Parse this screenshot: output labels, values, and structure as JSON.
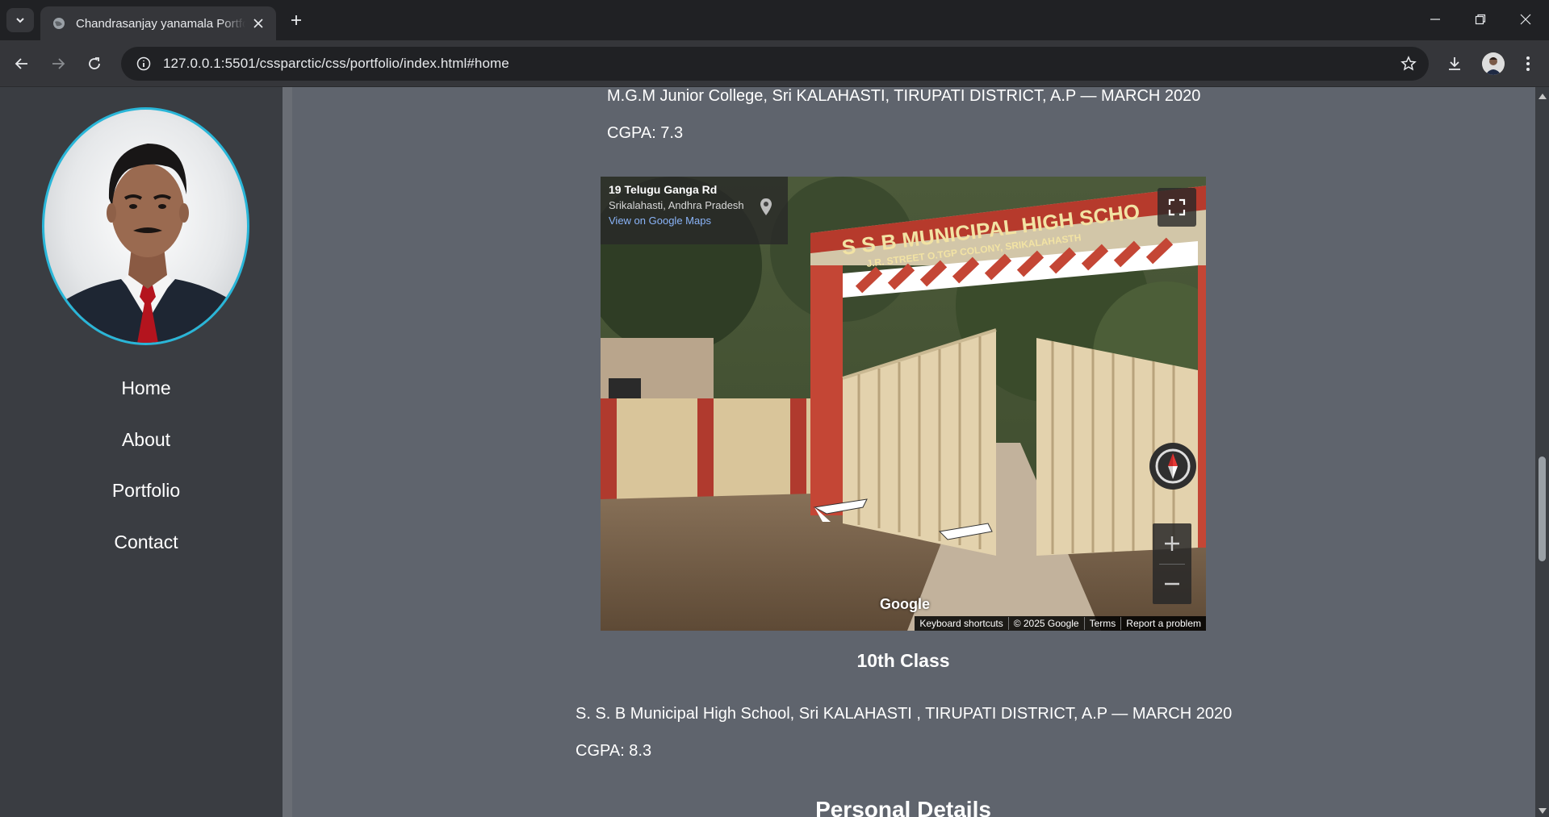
{
  "browser": {
    "tab_title": "Chandrasanjay yanamala Portfolio",
    "url": "127.0.0.1:5501/cssparctic/css/portfolio/index.html#home"
  },
  "sidebar": {
    "nav": [
      {
        "label": "Home"
      },
      {
        "label": "About"
      },
      {
        "label": "Portfolio"
      },
      {
        "label": "Contact"
      }
    ]
  },
  "education": {
    "intermediate": {
      "line": "M.G.M Junior College, Sri KALAHASTI, TIRUPATI DISTRICT, A.P — MARCH 2020",
      "cgpa": "CGPA: 7.3"
    },
    "tenth": {
      "title": "10th Class",
      "line": "S. S. B Municipal High School, Sri KALAHASTI , TIRUPATI DISTRICT, A.P — MARCH 2020",
      "cgpa": "CGPA: 8.3"
    }
  },
  "map": {
    "address_line1": "19 Telugu Ganga Rd",
    "address_line2": "Srikalahasti, Andhra Pradesh",
    "view_link": "View on Google Maps",
    "sign_text": "S S B MUNICIPAL HIGH SCHO",
    "sign_subtext": "J.R. STREET O.TGP COLONY, SRIKALAHASTH",
    "google_logo": "Google",
    "footer": {
      "shortcuts": "Keyboard shortcuts",
      "copyright": "© 2025 Google",
      "terms": "Terms",
      "report": "Report a problem"
    }
  },
  "section_next": {
    "title": "Personal Details"
  },
  "colors": {
    "page_bg": "#5f646d",
    "sidebar_bg": "#3a3d42",
    "profile_ring": "#29b6d8",
    "chrome_dark": "#202124",
    "chrome_mid": "#35363a"
  },
  "icons": [
    "tab-list-icon",
    "globe-favicon-icon",
    "close-icon",
    "plus-icon",
    "minimize-icon",
    "restore-icon",
    "back-arrow-icon",
    "forward-arrow-icon",
    "reload-icon",
    "site-info-icon",
    "star-icon",
    "download-icon",
    "kebab-menu-icon",
    "fullscreen-icon",
    "compass-icon",
    "zoom-in-icon",
    "zoom-out-icon",
    "map-pin-icon"
  ]
}
